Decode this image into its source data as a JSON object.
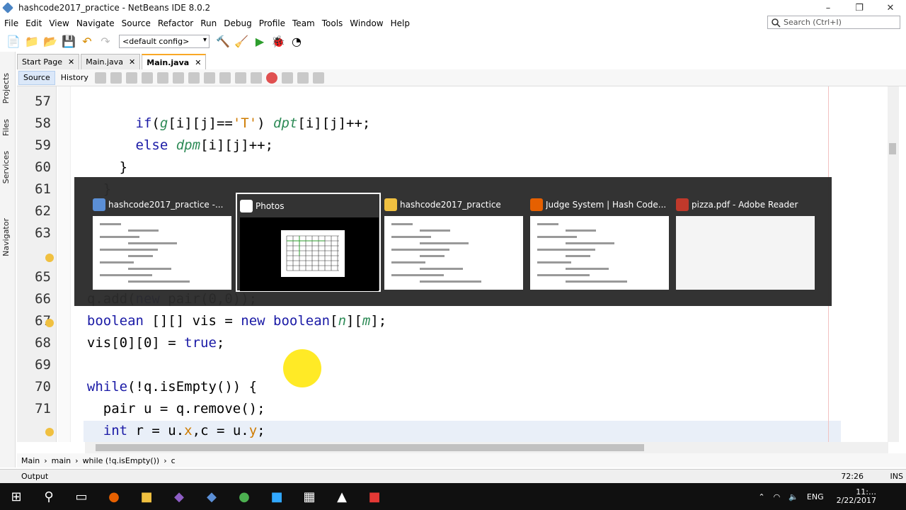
{
  "window": {
    "title": "hashcode2017_practice - NetBeans IDE 8.0.2",
    "min": "–",
    "max": "❐",
    "close": "✕"
  },
  "menu": [
    "File",
    "Edit",
    "View",
    "Navigate",
    "Source",
    "Refactor",
    "Run",
    "Debug",
    "Profile",
    "Team",
    "Tools",
    "Window",
    "Help"
  ],
  "search": {
    "placeholder": "Search (Ctrl+I)"
  },
  "toolbar": {
    "config": "<default config>"
  },
  "left_tabs": [
    "Projects",
    "Files",
    "Services",
    "Navigator"
  ],
  "tabs": [
    {
      "label": "Start Page",
      "active": false
    },
    {
      "label": "Main.java",
      "active": false
    },
    {
      "label": "Main.java",
      "active": true
    }
  ],
  "editor_toolbar": {
    "source": "Source",
    "history": "History"
  },
  "lines": [
    {
      "n": "57",
      "html": ""
    },
    {
      "n": "58",
      "html": "        <span class=\"kw\">if</span>(<span class=\"it\">g</span>[i][j]==<span class=\"str\">'T'</span>) <span class=\"it\">dpt</span>[i][j]++;"
    },
    {
      "n": "59",
      "html": "        <span class=\"kw\">else</span> <span class=\"it\">dpm</span>[i][j]++;"
    },
    {
      "n": "60",
      "html": "      }"
    },
    {
      "n": "61",
      "html": "    }"
    },
    {
      "n": "62",
      "html": ""
    },
    {
      "n": "63",
      "html": ""
    },
    {
      "n": "65",
      "html": ""
    },
    {
      "n": "66",
      "html": "  q.add(<span class=\"kw\">new</span> pair(0,0));"
    },
    {
      "n": "67",
      "html": "  <span class=\"kw\">boolean</span> [][] vis = <span class=\"kw\">new</span> <span class=\"kw\">boolean</span>[<span class=\"it\">n</span>][<span class=\"it\">m</span>];"
    },
    {
      "n": "68",
      "html": "  vis[0][0] = <span class=\"kw\">true</span>;"
    },
    {
      "n": "69",
      "html": ""
    },
    {
      "n": "70",
      "html": "  <span class=\"kw\">while</span>(!q.isEmpty()) {"
    },
    {
      "n": "71",
      "html": "    pair u = q.remove();"
    },
    {
      "n": "",
      "html": "    <span class=\"kw\">int</span> r = u.<span class=\"str\">x</span>,c = u.<span class=\"str\">y</span>;"
    }
  ],
  "switcher": [
    {
      "label": "hashcode2017_practice -...",
      "icon": "netbeans-icon",
      "color": "#5b8fd6"
    },
    {
      "label": "Photos",
      "icon": "photos-icon",
      "color": "#ffffff"
    },
    {
      "label": "hashcode2017_practice",
      "icon": "folder-icon",
      "color": "#f0c040"
    },
    {
      "label": "Judge System | Hash Code...",
      "icon": "firefox-icon",
      "color": "#e66000"
    },
    {
      "label": "pizza.pdf - Adobe Reader",
      "icon": "pdf-icon",
      "color": "#c0392b"
    }
  ],
  "breadcrumb": [
    "Main",
    "main",
    "while (!q.isEmpty())",
    "c"
  ],
  "status": {
    "position": "72:26",
    "ins": "INS"
  },
  "output": {
    "label": "Output"
  },
  "tray": {
    "lang": "ENG",
    "time": "11:…",
    "date": "2/22/2017"
  }
}
